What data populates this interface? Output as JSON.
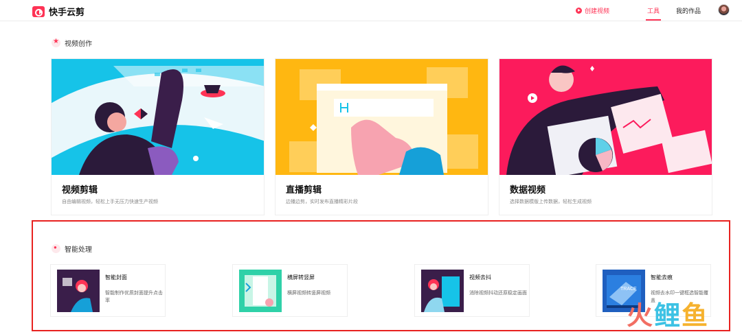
{
  "header": {
    "brand": "快手云剪",
    "create_label": "创建视频",
    "nav_tools": "工具",
    "nav_works": "我的作品"
  },
  "sections": {
    "creation_title": "视频创作",
    "smart_title": "智能处理"
  },
  "cards": [
    {
      "title": "视频剪辑",
      "desc": "自由编辑视频，轻松上手无压力快速生产视频"
    },
    {
      "title": "直播剪辑",
      "desc": "边播边剪，实时发布直播精彩片段"
    },
    {
      "title": "数据视频",
      "desc": "选择数据模版上传数据，轻松生成视频"
    }
  ],
  "tools": [
    {
      "name": "智能封面",
      "desc": "智能制作优质封面提升点击率"
    },
    {
      "name": "横屏转竖屏",
      "desc": "横屏视频转竖屏视频"
    },
    {
      "name": "视频去抖",
      "desc": "消除视频抖动还原稳定画面"
    },
    {
      "name": "智能去痕",
      "desc": "视频去水印一键框选智能覆盖"
    }
  ],
  "illustration_text": {
    "trace_label": "TRACE"
  },
  "watermark": [
    "火",
    "鲤",
    "鱼"
  ],
  "colors": {
    "accent": "#fe3355",
    "card1_bg": "#16c3e8",
    "card2_bg": "#ffb711",
    "card3_bg": "#fc1b5c",
    "highlight_box": "#e8211f"
  }
}
